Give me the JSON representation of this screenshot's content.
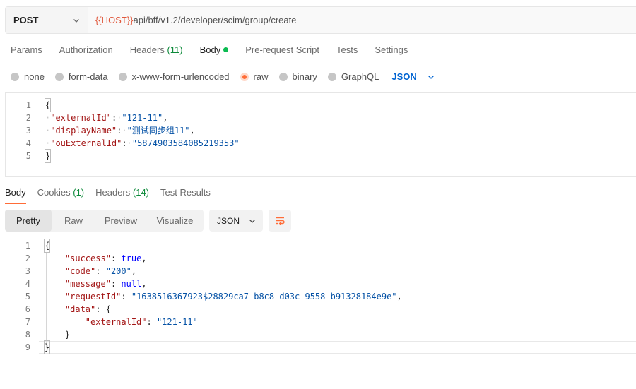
{
  "request": {
    "method": "POST",
    "url_variable": "{{HOST}}",
    "url_path": "api/bff/v1.2/developer/scim/group/create"
  },
  "request_tabs": [
    {
      "label": "Params"
    },
    {
      "label": "Authorization"
    },
    {
      "label": "Headers",
      "count": "(11)"
    },
    {
      "label": "Body",
      "active": true
    },
    {
      "label": "Pre-request Script"
    },
    {
      "label": "Tests"
    },
    {
      "label": "Settings"
    }
  ],
  "body_types": [
    {
      "label": "none",
      "checked": false
    },
    {
      "label": "form-data",
      "checked": false
    },
    {
      "label": "x-www-form-urlencoded",
      "checked": false
    },
    {
      "label": "raw",
      "checked": true
    },
    {
      "label": "binary",
      "checked": false
    },
    {
      "label": "GraphQL",
      "checked": false
    }
  ],
  "body_language": "JSON",
  "request_body": {
    "line_numbers": [
      "1",
      "2",
      "3",
      "4",
      "5"
    ],
    "open_brace": "{",
    "close_brace": "}",
    "fields": [
      {
        "key": "\"externalId\"",
        "value": "\"121-11\"",
        "comma": ","
      },
      {
        "key": "\"displayName\"",
        "value": "\"测试同步组11\"",
        "comma": ","
      },
      {
        "key": "\"ouExternalId\"",
        "value": "\"5874903584085219353\"",
        "comma": ""
      }
    ]
  },
  "response_tabs": [
    {
      "label": "Body",
      "active": true
    },
    {
      "label": "Cookies",
      "count": "(1)"
    },
    {
      "label": "Headers",
      "count": "(14)"
    },
    {
      "label": "Test Results"
    }
  ],
  "view_modes": [
    {
      "label": "Pretty",
      "active": true
    },
    {
      "label": "Raw"
    },
    {
      "label": "Preview"
    },
    {
      "label": "Visualize"
    }
  ],
  "response_format": "JSON",
  "response_body": {
    "line_numbers": [
      "1",
      "2",
      "3",
      "4",
      "5",
      "6",
      "7",
      "8",
      "9"
    ],
    "open_brace": "{",
    "close_brace": "}",
    "success_key": "\"success\"",
    "success_val": "true",
    "code_key": "\"code\"",
    "code_val": "\"200\"",
    "message_key": "\"message\"",
    "message_val": "null",
    "requestId_key": "\"requestId\"",
    "requestId_val": "\"1638516367923$28829ca7-b8c8-d03c-9558-b91328184e9e\"",
    "data_key": "\"data\"",
    "data_open": "{",
    "externalId_key": "\"externalId\"",
    "externalId_val": "\"121-11\"",
    "data_close": "}"
  },
  "colors": {
    "accent": "#ff6c37",
    "status_green": "#0cbb52",
    "link_blue": "#0265d2",
    "json_key": "#a31515",
    "json_string": "#0451a5",
    "json_keyword": "#0000ff"
  }
}
